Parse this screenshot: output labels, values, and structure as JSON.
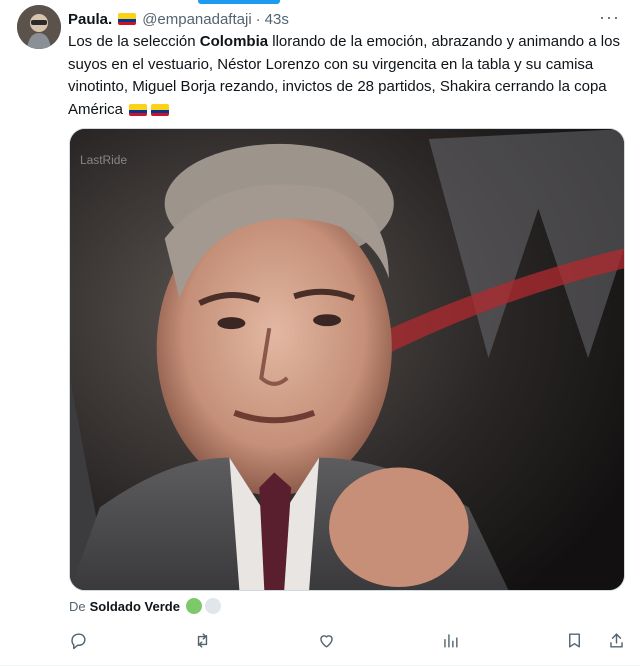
{
  "tweet": {
    "author_name": "Paula.",
    "author_handle": "@empanadaftaji",
    "separator": "·",
    "time_ago": "43s",
    "more_icon": "more-dots-icon",
    "text_before": "Los de la selección ",
    "text_bold": "Colombia",
    "text_after": " llorando de la emoción, abrazando y animando a los suyos en el vestuario, Néstor Lorenzo con su virgencita en la tabla y su camisa vinotinto, Miguel Borja rezando, invictos de 28 partidos, Shakira cerrando la copa América",
    "flag_icon": "colombia-flag-icon",
    "media": {
      "watermark": "LastRide",
      "description_icon": "video-gif-thumbnail"
    },
    "source_prefix": "De",
    "source_name": "Soldado Verde",
    "colors": {
      "text": "#0f1419",
      "muted": "#536471",
      "accent": "#1d9bf0",
      "flag_yellow": "#fcd116",
      "flag_blue": "#003893",
      "flag_red": "#ce1126",
      "source_circle_green": "#7dc96a"
    }
  },
  "actions": [
    {
      "name": "reply",
      "icon": "reply-icon"
    },
    {
      "name": "repost",
      "icon": "repost-icon"
    },
    {
      "name": "like",
      "icon": "like-icon"
    },
    {
      "name": "views",
      "icon": "views-icon"
    },
    {
      "name": "bookmark",
      "icon": "bookmark-icon"
    },
    {
      "name": "share",
      "icon": "share-icon"
    }
  ]
}
